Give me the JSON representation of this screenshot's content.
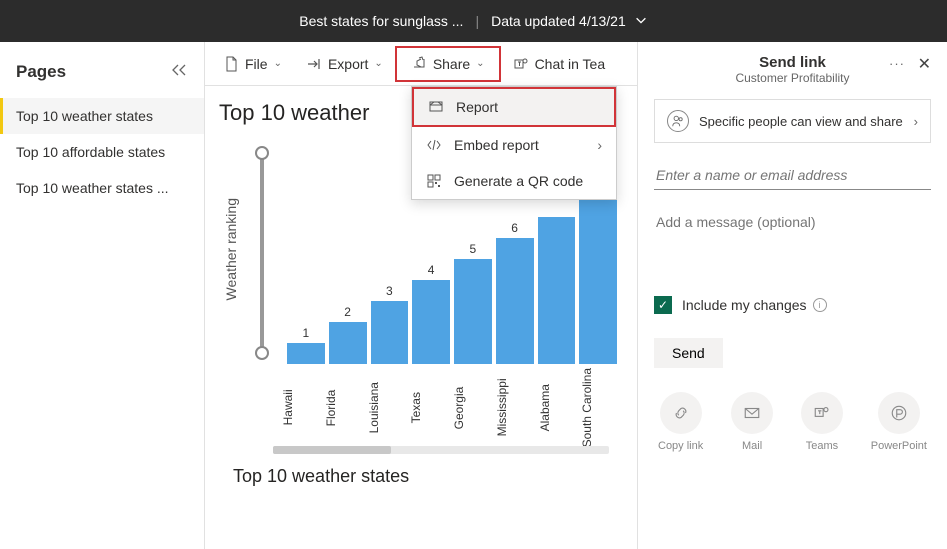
{
  "topbar": {
    "title": "Best states for sunglass ...",
    "updated": "Data updated 4/13/21"
  },
  "pages": {
    "header": "Pages",
    "items": [
      {
        "label": "Top 10 weather states",
        "active": true
      },
      {
        "label": "Top 10 affordable states",
        "active": false
      },
      {
        "label": "Top 10 weather states ...",
        "active": false
      }
    ]
  },
  "toolbar": {
    "file": "File",
    "export": "Export",
    "share": "Share",
    "chat": "Chat in Tea"
  },
  "share_menu": {
    "report": "Report",
    "embed": "Embed report",
    "qr": "Generate a QR code"
  },
  "report": {
    "title1": "Top 10 weather",
    "title2": "Top 10 weather states",
    "ylabel": "Weather ranking"
  },
  "chart_data": {
    "type": "bar",
    "title": "Top 10 weather states",
    "ylabel": "Weather ranking",
    "categories": [
      "Hawaii",
      "Florida",
      "Louisiana",
      "Texas",
      "Georgia",
      "Mississippi",
      "Alabama",
      "South Carolina"
    ],
    "values": [
      1,
      2,
      3,
      4,
      5,
      6,
      7,
      8
    ],
    "ylim": [
      0,
      10
    ]
  },
  "panel": {
    "title": "Send link",
    "subtitle": "Customer Profitability",
    "perm": "Specific people can view and share",
    "name_ph": "Enter a name or email address",
    "msg_ph": "Add a message (optional)",
    "include": "Include my changes",
    "send": "Send",
    "icons": {
      "copy": "Copy link",
      "mail": "Mail",
      "teams": "Teams",
      "ppt": "PowerPoint"
    }
  }
}
